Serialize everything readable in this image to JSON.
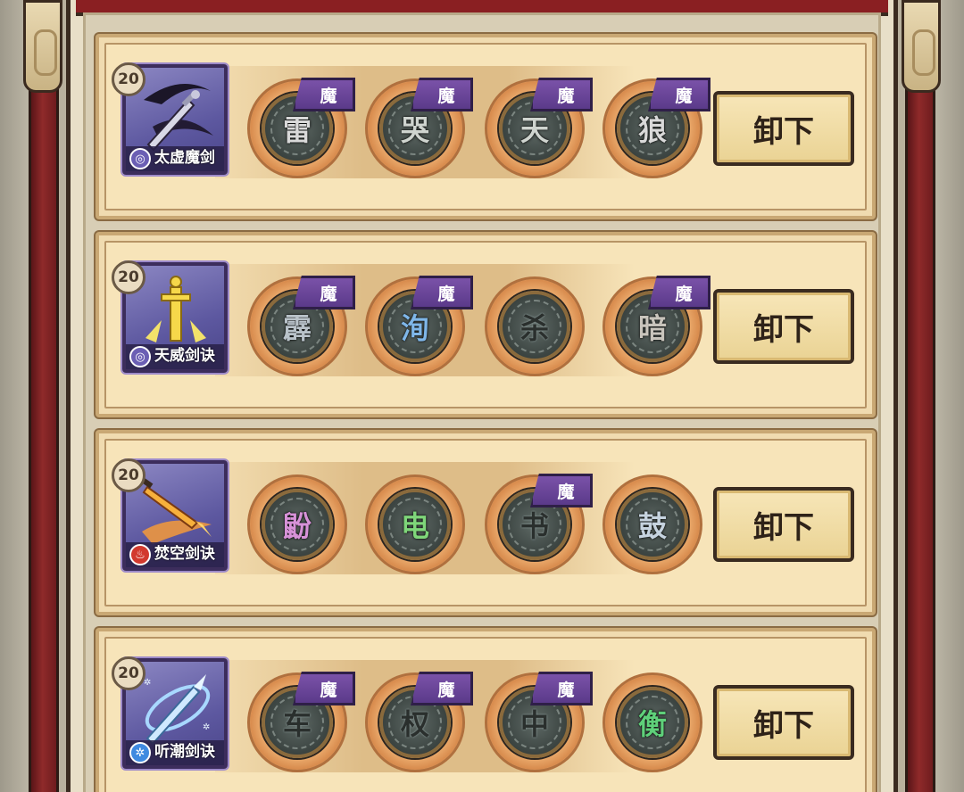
{
  "rows": [
    {
      "skill": {
        "name": "太虚魔剑",
        "level": "20",
        "element_icon": "purple-swirl-icon",
        "element_color": "#6b5fb4",
        "art": "dark-sword-icon"
      },
      "runes": [
        {
          "char": "雷",
          "color": "#d9d9d9",
          "tag": "魔"
        },
        {
          "char": "哭",
          "color": "#cfd4cf",
          "tag": "魔"
        },
        {
          "char": "天",
          "color": "#cfd4cf",
          "tag": "魔"
        },
        {
          "char": "狼",
          "color": "#d9d9d9",
          "tag": "魔"
        }
      ],
      "button": "卸下"
    },
    {
      "skill": {
        "name": "天威剑诀",
        "level": "20",
        "element_icon": "purple-swirl-icon",
        "element_color": "#6b5fb4",
        "art": "golden-sword-icon"
      },
      "runes": [
        {
          "char": "霹",
          "color": "#b9c2c9",
          "tag": "魔"
        },
        {
          "char": "洵",
          "color": "#7fb6e8",
          "tag": "魔"
        },
        {
          "char": "杀",
          "color": "#2a2f2d",
          "tag": ""
        },
        {
          "char": "暗",
          "color": "#c8c4bc",
          "tag": "魔"
        }
      ],
      "button": "卸下"
    },
    {
      "skill": {
        "name": "焚空剑诀",
        "level": "20",
        "element_icon": "flame-icon",
        "element_color": "#d23a2e",
        "art": "fire-sword-icon"
      },
      "runes": [
        {
          "char": "鼢",
          "color": "#d792d8",
          "tag": ""
        },
        {
          "char": "电",
          "color": "#7fd67a",
          "tag": ""
        },
        {
          "char": "书",
          "color": "#2a2f2d",
          "tag": "魔"
        },
        {
          "char": "鼓",
          "color": "#c6d3df",
          "tag": ""
        }
      ],
      "button": "卸下"
    },
    {
      "skill": {
        "name": "听潮剑诀",
        "level": "20",
        "element_icon": "snowflake-icon",
        "element_color": "#3f8ae0",
        "art": "ice-sword-icon"
      },
      "runes": [
        {
          "char": "车",
          "color": "#2a2f2d",
          "tag": "魔"
        },
        {
          "char": "权",
          "color": "#2a2f2d",
          "tag": "魔"
        },
        {
          "char": "中",
          "color": "#2a2f2d",
          "tag": "魔"
        },
        {
          "char": "衡",
          "color": "#5fd07a",
          "tag": ""
        }
      ],
      "button": "卸下"
    }
  ]
}
